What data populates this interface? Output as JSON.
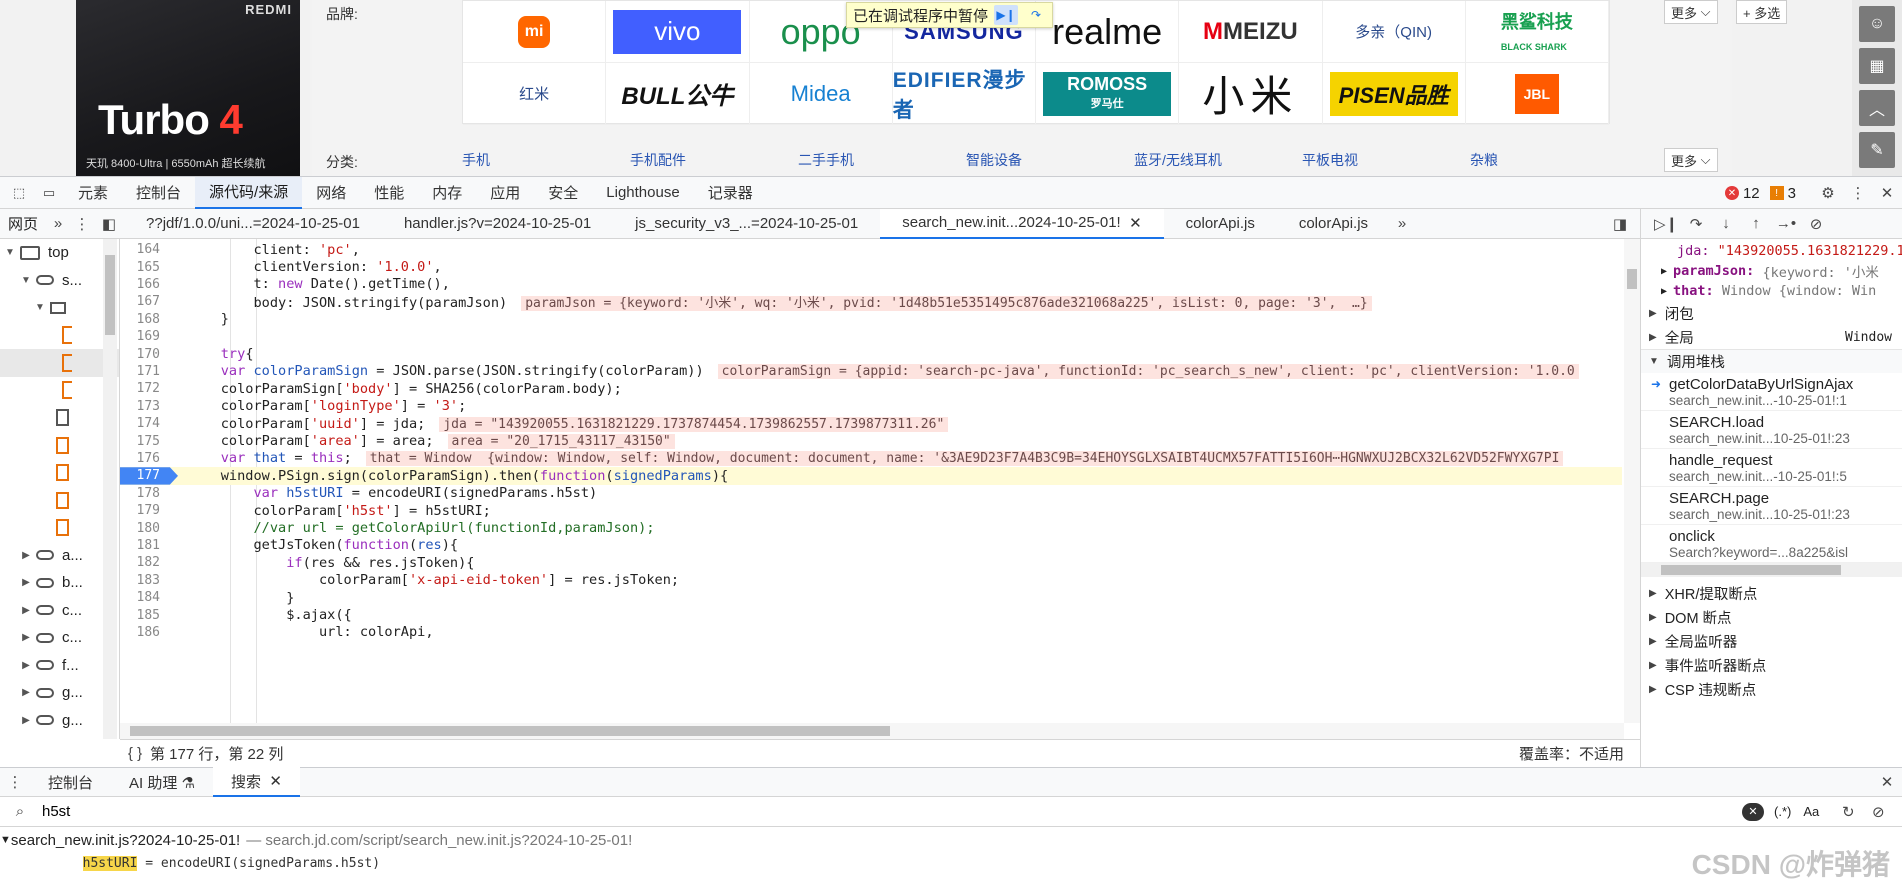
{
  "page": {
    "promo": {
      "brand": "REDMI",
      "title_main": "Turbo",
      "title_num": "4",
      "spec": "天玑 8400-Ultra  |  6550mAh 超长续航"
    },
    "brand_label": "品牌:",
    "category_label": "分类:",
    "brands_row1": [
      "mi",
      "vivo",
      "oppo",
      "SAMSUNG",
      "realme",
      "MEIZU",
      "多亲（QIN)",
      "黑鲨科技"
    ],
    "brands_row2": [
      "红米",
      "BULL公牛",
      "Midea",
      "EDIFIER漫步者",
      "ROMOSS",
      "小米",
      "PISEN品胜",
      "JBL"
    ],
    "romoss_sub": "罗马仕",
    "blackshark_sub": "BLACK SHARK",
    "debug_banner": "已在调试程序中暂停",
    "more_label": "更多",
    "multi_label": "+ 多选",
    "categories": [
      "手机",
      "手机配件",
      "二手手机",
      "智能设备",
      "蓝牙/无线耳机",
      "平板电视",
      "杂粮"
    ]
  },
  "devtools": {
    "main_tabs": [
      "元素",
      "控制台",
      "源代码/来源",
      "网络",
      "性能",
      "内存",
      "应用",
      "安全",
      "Lighthouse",
      "记录器"
    ],
    "active_tab": "源代码/来源",
    "errors": "12",
    "warnings": "3",
    "navigator_tab": "网页",
    "file_tabs": [
      "??jdf/1.0.0/uni...=2024-10-25-01",
      "handler.js?v=2024-10-25-01",
      "js_security_v3_...=2024-10-25-01",
      "search_new.init...2024-10-25-01!",
      "colorApi.js",
      "colorApi.js"
    ],
    "tree": {
      "top": "top",
      "root_s": "s...",
      "clouds": [
        "a...",
        "b...",
        "c...",
        "c...",
        "f...",
        "g...",
        "g..."
      ]
    },
    "code": [
      {
        "n": "164",
        "html": "        client: <span class='str'>'pc'</span>,"
      },
      {
        "n": "165",
        "html": "        clientVersion: <span class='str'>'1.0.0'</span>,"
      },
      {
        "n": "166",
        "html": "        t: <span class='kw'>new</span> Date().getTime(),"
      },
      {
        "n": "167",
        "html": "        body: JSON.stringify(paramJson)<span class='inline-val'>paramJson = {keyword: '小米', wq: '小米', pvid: '1d48b51e5351495c876ade321068a225', isList: 0, page: '3',  …}</span>"
      },
      {
        "n": "168",
        "html": "    }"
      },
      {
        "n": "169",
        "html": ""
      },
      {
        "n": "170",
        "html": "    <span class='kw'>try</span>{"
      },
      {
        "n": "171",
        "html": "    <span class='kw'>var</span> <span class='fn'>colorParamSign</span> = JSON.parse(JSON.stringify(colorParam))<span class='inline-val'>colorParamSign = {appid: 'search-pc-java', functionId: 'pc_search_s_new', client: 'pc', clientVersion: '1.0.0</span>"
      },
      {
        "n": "172",
        "html": "    colorParamSign[<span class='str'>'body'</span>] = SHA256(colorParam.body);"
      },
      {
        "n": "173",
        "html": "    colorParam[<span class='str'>'loginType'</span>] = <span class='str'>'3'</span>;"
      },
      {
        "n": "174",
        "html": "    colorParam[<span class='str'>'uuid'</span>] = jda;<span class='inline-val'>jda = \"143920055.1631821229.1737874454.1739862557.1739877311.26\"</span>"
      },
      {
        "n": "175",
        "html": "    colorParam[<span class='str'>'area'</span>] = area;<span class='inline-val'>area = \"20_1715_43117_43150\"</span>"
      },
      {
        "n": "176",
        "html": "    <span class='kw'>var</span> <span class='fn'>that</span> = <span class='kw'>this</span>;<span class='inline-val'>that = Window  {window: Window, self: Window, document: document, name: '&3AE9D23F7A4B3C9B=34EHOYSGLXSAIBT4UCMX57FATTI5I6OH⋯HGNWXUJ2BCX32L62VD52FWYXG7PI</span>"
      },
      {
        "n": "177",
        "html": "    window.PSign.sign(colorParamSign).then(<span class='kw'>function</span>(<span class='fn'>signedParams</span>){"
      },
      {
        "n": "178",
        "html": "        <span class='kw'>var</span> <span class='fn'>h5stURI</span> = encodeURI(signedParams.h5st)"
      },
      {
        "n": "179",
        "html": "        colorParam[<span class='str'>'h5st'</span>] = h5stURI;"
      },
      {
        "n": "180",
        "html": "        <span class='cm'>//var url = getColorApiUrl(functionId,paramJson);</span>"
      },
      {
        "n": "181",
        "html": "        getJsToken(<span class='kw'>function</span>(<span class='fn'>res</span>){"
      },
      {
        "n": "182",
        "html": "            <span class='kw'>if</span>(res &amp;&amp; res.jsToken){"
      },
      {
        "n": "183",
        "html": "                colorParam[<span class='str'>'x-api-eid-token'</span>] = res.jsToken;"
      },
      {
        "n": "184",
        "html": "            }"
      },
      {
        "n": "185",
        "html": "            $.ajax({"
      },
      {
        "n": "186",
        "html": "                url: colorApi,"
      }
    ],
    "paused_line": "177",
    "status": "第 177 行，第 22 列",
    "coverage": "覆盖率：不适用",
    "scope": {
      "jda_key": "jda:",
      "jda_val": "\"143920055.1631821229.1",
      "paramJson_key": "paramJson:",
      "paramJson_val": "{keyword: '小米",
      "that_key": "that:",
      "that_val": "Window  {window: Win"
    },
    "closure_label": "闭包",
    "global_label": "全局",
    "global_val": "Window",
    "callstack_label": "调用堆栈",
    "frames": [
      {
        "name": "getColorDataByUrlSignAjax",
        "loc": "search_new.init...-10-25-01!:1"
      },
      {
        "name": "SEARCH.load",
        "loc": "search_new.init...10-25-01!:23"
      },
      {
        "name": "handle_request",
        "loc": "search_new.init...-10-25-01!:5"
      },
      {
        "name": "SEARCH.page",
        "loc": "search_new.init...10-25-01!:23"
      },
      {
        "name": "onclick",
        "loc": "Search?keyword=...8a225&isl"
      }
    ],
    "bp_sections": [
      "XHR/提取断点",
      "DOM 断点",
      "全局监听器",
      "事件监听器断点",
      "CSP 违规断点"
    ],
    "drawer_tabs": [
      "控制台",
      "AI 助理 ⚗",
      "搜索"
    ],
    "search_query": "h5st",
    "search_opts": [
      "(.*)",
      "Aa"
    ],
    "result_file": "search_new.init.js?2024-10-25-01!",
    "result_path": "— search.jd.com/script/search_new.init.js?2024-10-25-01!",
    "result_line_pre": "        ",
    "result_line_hl": "h5stURI",
    "result_line_post": " = encodeURI(signedParams.h5st)",
    "watermark": "CSDN @炸弹猪"
  }
}
